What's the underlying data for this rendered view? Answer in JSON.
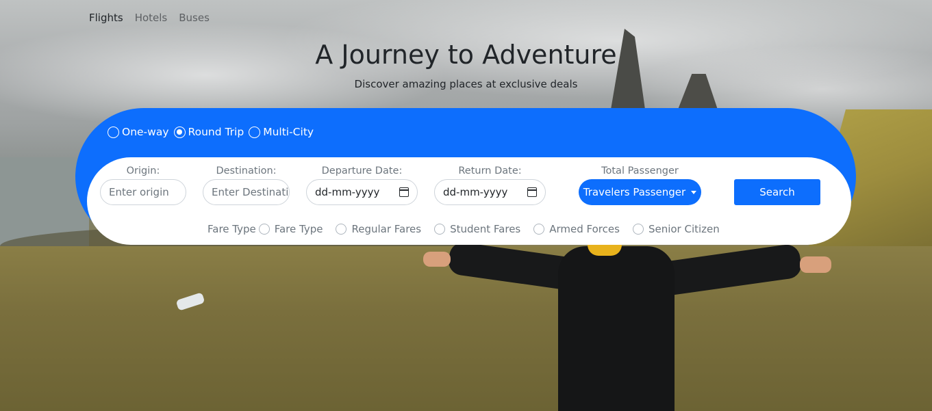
{
  "nav": {
    "items": [
      "Flights",
      "Hotels",
      "Buses"
    ],
    "active": "Flights"
  },
  "hero": {
    "title": "A Journey to Adventure",
    "subtitle": "Discover amazing places at exclusive deals"
  },
  "trip_types": {
    "options": [
      "One-way",
      "Round Trip",
      "Multi-City"
    ],
    "selected": "Round Trip"
  },
  "form": {
    "origin": {
      "label": "Origin:",
      "placeholder": "Enter origin"
    },
    "destination": {
      "label": "Destination:",
      "placeholder": "Enter Destinati"
    },
    "departure": {
      "label": "Departure Date:",
      "value": "dd-mm-yyyy"
    },
    "return": {
      "label": "Return Date:",
      "value": "dd-mm-yyyy"
    },
    "passengers": {
      "label": "Total Passenger",
      "button": "Travelers Passenger"
    },
    "search_label": "Search"
  },
  "fares": {
    "label": "Fare Type",
    "options": [
      "Fare Type",
      "Regular Fares",
      "Student Fares",
      "Armed Forces",
      "Senior Citizen"
    ]
  },
  "colors": {
    "primary": "#0d6efd",
    "text": "#212529",
    "muted": "#6c757d"
  },
  "icons": [
    "calendar-icon",
    "caret-down-icon"
  ]
}
